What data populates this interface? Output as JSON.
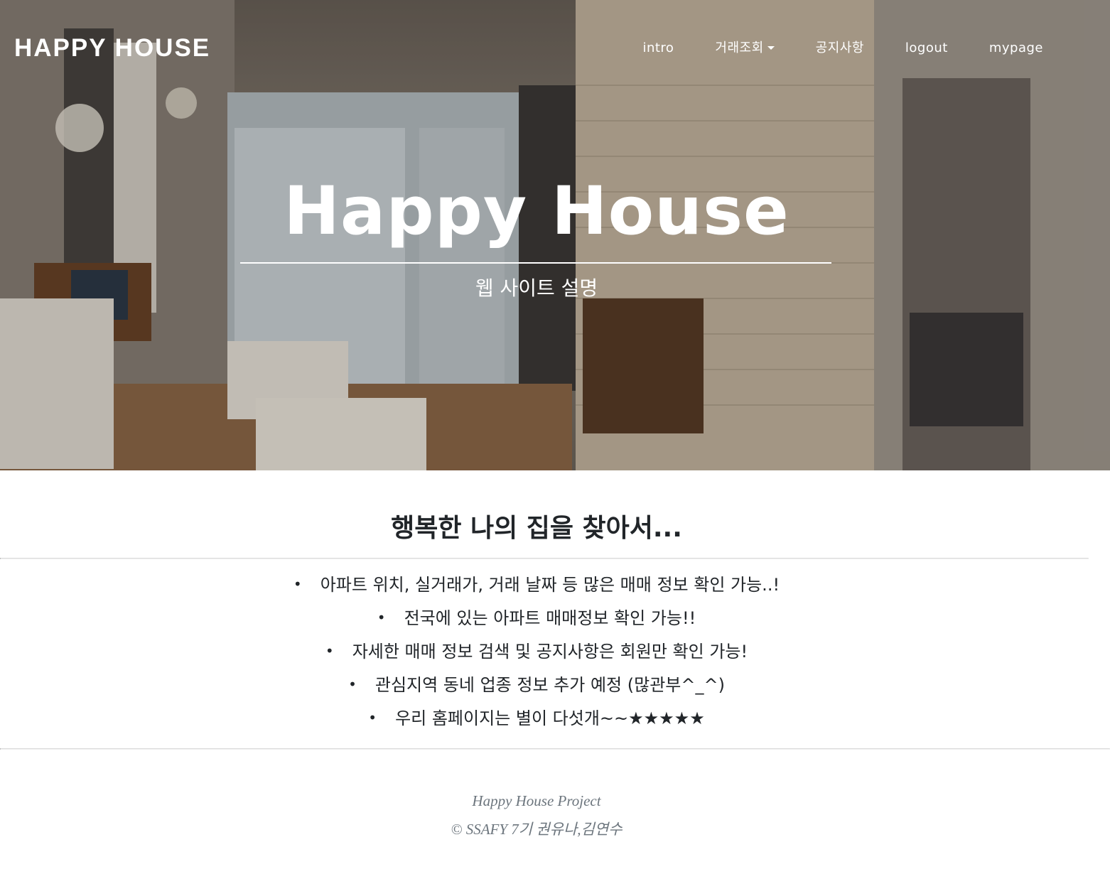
{
  "navbar": {
    "brand": "HAPPY HOUSE",
    "links": [
      {
        "label": "intro"
      },
      {
        "label": "거래조회"
      },
      {
        "label": "공지사항"
      },
      {
        "label": "logout"
      },
      {
        "label": "mypage"
      }
    ]
  },
  "hero": {
    "title": "Happy House",
    "subtitle": "웹 사이트 설명",
    "background_description_colors": {
      "wall": "#cfc3b0",
      "floor": "#9b6e45",
      "window": "#c9d3d8"
    }
  },
  "main": {
    "heading": "행복한 나의 집을 찾아서...",
    "bullet_glyph": "•",
    "features": [
      "아파트 위치, 실거래가, 거래 날짜 등 많은 매매 정보 확인 가능..!",
      "전국에 있는 아파트 매매정보 확인 가능!!",
      "자세한 매매 정보 검색 및 공지사항은 회원만 확인 가능!",
      "관심지역 동네 업종 정보 추가 예정 (많관부^_^)",
      "우리 홈페이지는 별이 다섯개~~★★★★★"
    ]
  },
  "footer": {
    "project": "Happy House Project",
    "copyright": "© SSAFY 7기 권유나,김연수"
  },
  "colors": {
    "text": "#212529",
    "muted": "#6c757d",
    "white": "#ffffff"
  }
}
